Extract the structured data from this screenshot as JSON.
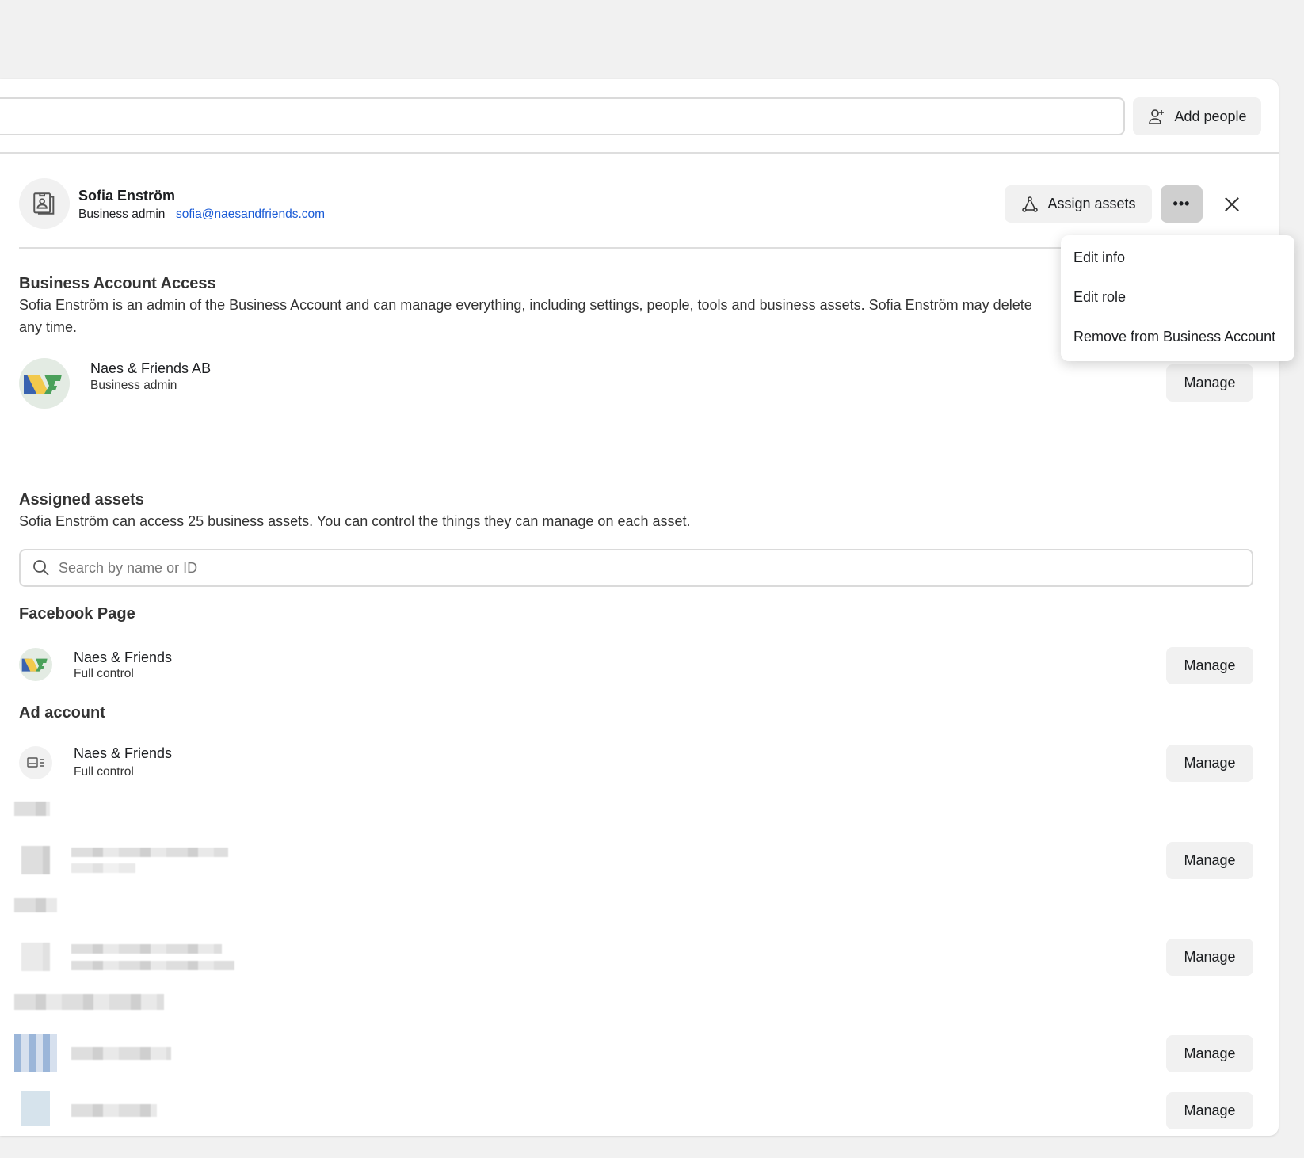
{
  "toolbar": {
    "search_value": "",
    "add_people_label": "Add people",
    "add_people_icon": "person-add-icon"
  },
  "person": {
    "name": "Sofia Enström",
    "role": "Business admin",
    "email": "sofia@naesandfriends.com",
    "assign_assets_label": "Assign assets",
    "more_icon": "ellipsis-icon",
    "close_icon": "close-icon",
    "link_color": "#1a5bd6"
  },
  "menu": {
    "items": [
      "Edit info",
      "Edit role",
      "Remove from Business Account"
    ]
  },
  "business_access": {
    "title": "Business Account Access",
    "description_line1": "Sofia Enström is an admin of the Business Account and can manage everything, including settings, people, tools and business assets. Sofia Enström may delete",
    "description_line2": "any time.",
    "account": {
      "name": "Naes & Friends AB",
      "role": "Business admin",
      "manage_label": "Manage"
    }
  },
  "assigned": {
    "title": "Assigned assets",
    "description": "Sofia Enström can access 25 business assets. You can control the things they can manage on each asset.",
    "search_placeholder": "Search by name or ID",
    "groups": [
      {
        "title": "Facebook Page",
        "items": [
          {
            "name": "Naes & Friends",
            "access": "Full control",
            "manage_label": "Manage"
          }
        ]
      },
      {
        "title": "Ad account",
        "items": [
          {
            "name": "Naes & Friends",
            "access": "Full control",
            "manage_label": "Manage"
          }
        ]
      }
    ],
    "blurred_manage_labels": [
      "Manage",
      "Manage",
      "Manage",
      "Manage"
    ]
  }
}
